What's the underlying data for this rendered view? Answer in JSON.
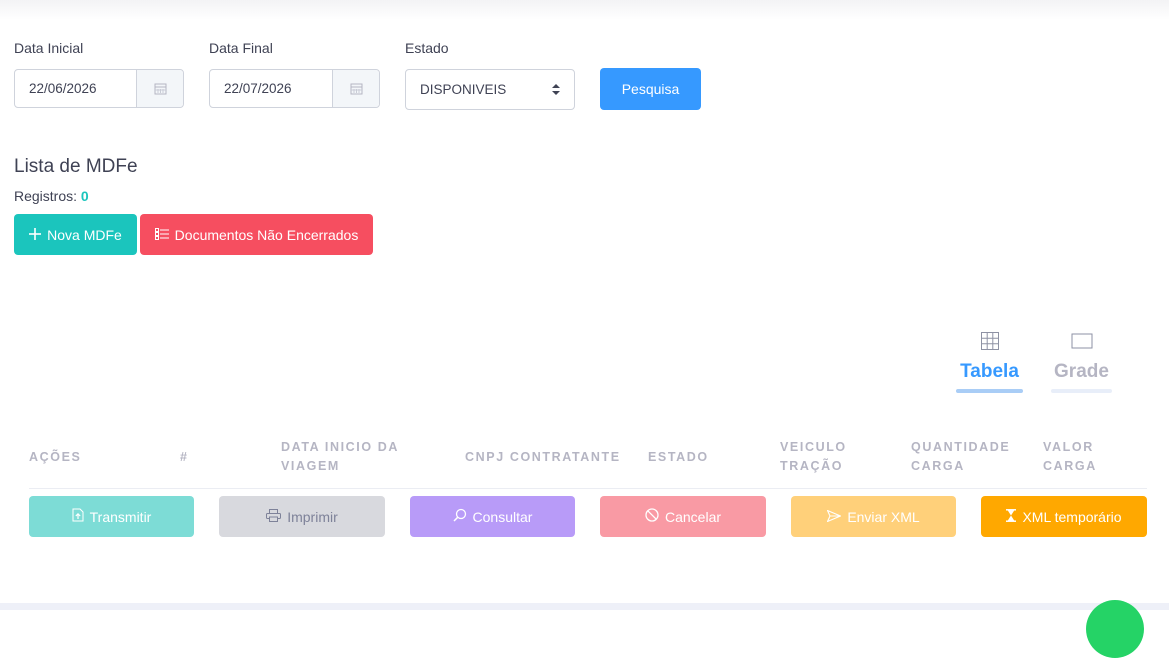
{
  "filters": {
    "data_inicial": {
      "label": "Data Inicial",
      "value": "22/06/2026"
    },
    "data_final": {
      "label": "Data Final",
      "value": "22/07/2026"
    },
    "estado": {
      "label": "Estado",
      "value": "DISPONIVEIS"
    },
    "search_label": "Pesquisa"
  },
  "list": {
    "title": "Lista de MDFe",
    "registros_label": "Registros:",
    "registros_count": "0",
    "new_button": "Nova MDFe",
    "open_docs_button": "Documentos Não Encerrados"
  },
  "view_toggle": {
    "tabela": "Tabela",
    "grade": "Grade",
    "active": "Tabela"
  },
  "table": {
    "headers": [
      "AÇÕES",
      "#",
      "DATA INICIO DA VIAGEM",
      "CNPJ CONTRATANTE",
      "ESTADO",
      "VEICULO TRAÇÃO",
      "QUANTIDADE CARGA",
      "VALOR CARGA"
    ]
  },
  "actions": {
    "transmitir": "Transmitir",
    "imprimir": "Imprimir",
    "consultar": "Consultar",
    "cancelar": "Cancelar",
    "enviar_xml": "Enviar XML",
    "xml_temporario": "XML temporário"
  },
  "colors": {
    "primary": "#3699ff",
    "success": "#1bc5bd",
    "danger": "#f64e60",
    "info": "#8950fc",
    "warning": "#ffa800"
  }
}
